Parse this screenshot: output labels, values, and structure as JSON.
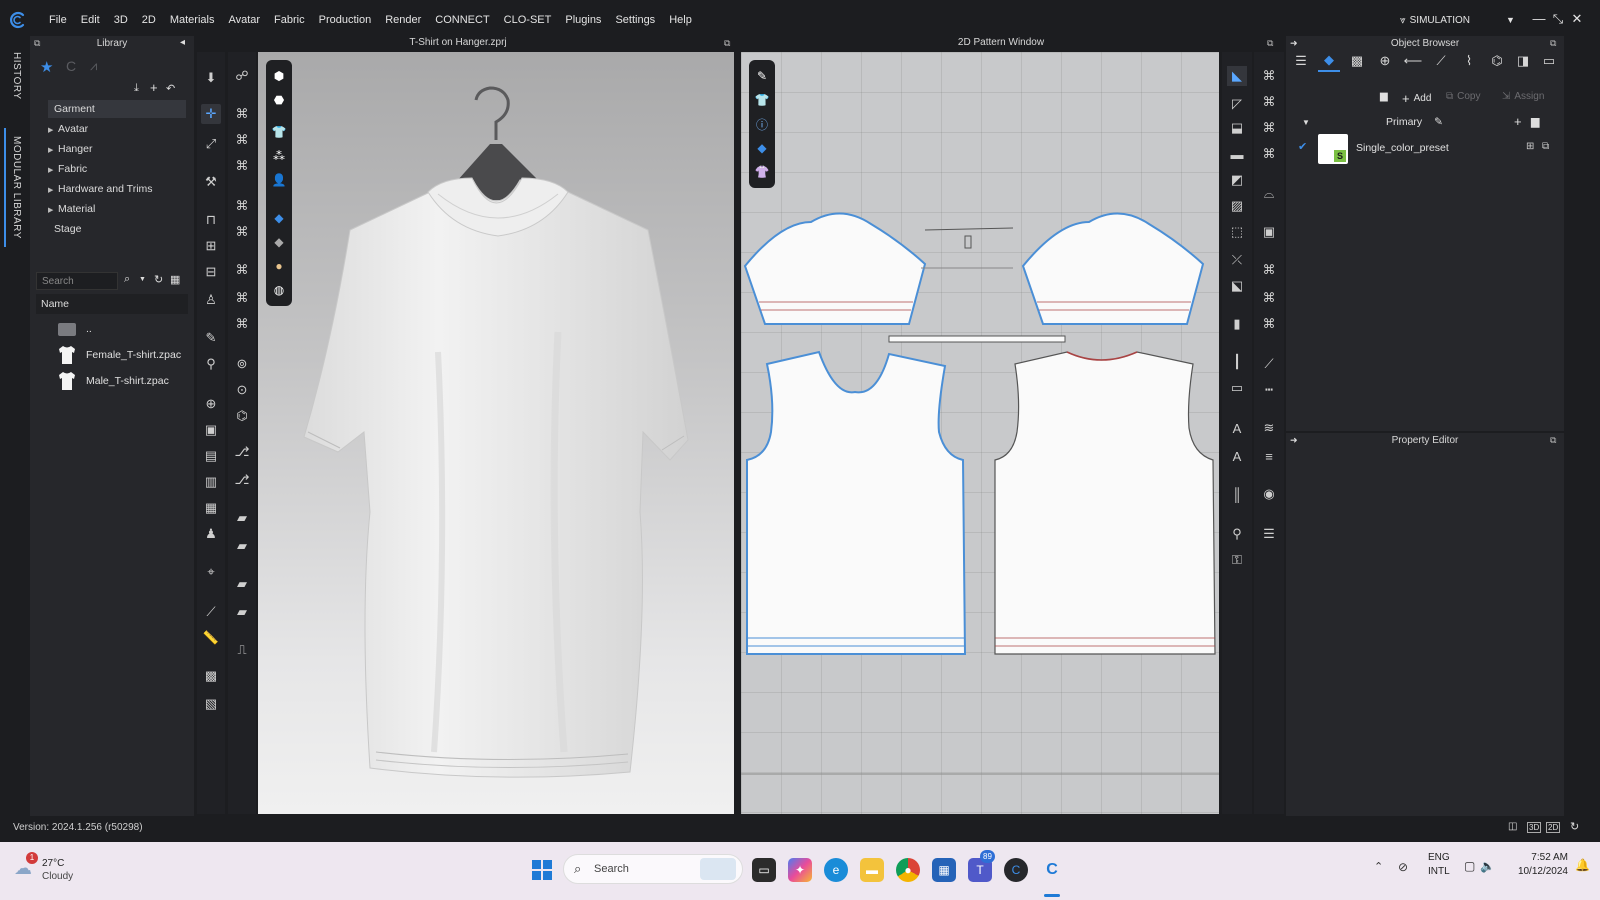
{
  "app": {
    "menus": [
      "File",
      "Edit",
      "3D",
      "2D",
      "Materials",
      "Avatar",
      "Fabric",
      "Production",
      "Render",
      "CONNECT",
      "CLO-SET",
      "Plugins",
      "Settings",
      "Help"
    ],
    "mode_label": "SIMULATION"
  },
  "side_tabs": {
    "history": "HISTORY",
    "modular_library": "MODULAR LIBRARY"
  },
  "library": {
    "title": "Library",
    "tree": [
      {
        "label": "Garment",
        "expandable": false,
        "selected": true
      },
      {
        "label": "Avatar",
        "expandable": true
      },
      {
        "label": "Hanger",
        "expandable": true
      },
      {
        "label": "Fabric",
        "expandable": true
      },
      {
        "label": "Hardware and Trims",
        "expandable": true
      },
      {
        "label": "Material",
        "expandable": true
      },
      {
        "label": "Stage",
        "expandable": false
      }
    ],
    "search_placeholder": "Search",
    "column_name": "Name",
    "files": [
      {
        "label": "..",
        "icon": "folder-icon"
      },
      {
        "label": "Female_T-shirt.zpac",
        "icon": "tshirt-icon"
      },
      {
        "label": "Male_T-shirt.zpac",
        "icon": "tshirt-icon"
      }
    ]
  },
  "viewport3d": {
    "title": "T-Shirt on Hanger.zprj"
  },
  "viewport2d": {
    "title": "2D Pattern Window"
  },
  "object_browser": {
    "title": "Object Browser",
    "add_label": "Add",
    "copy_label": "Copy",
    "assign_label": "Assign",
    "group_label": "Primary",
    "fabric_name": "Single_color_preset"
  },
  "property_editor": {
    "title": "Property Editor"
  },
  "status": {
    "version": "Version: 2024.1.256 (r50298)"
  },
  "taskbar": {
    "weather_temp": "27°C",
    "weather_desc": "Cloudy",
    "weather_badge": "1",
    "search_placeholder": "Search",
    "teams_badge": "89",
    "lang_1": "ENG",
    "lang_2": "INTL",
    "time": "7:52 AM",
    "date": "10/12/2024"
  },
  "colors": {
    "accent_blue": "#3d8ee8",
    "app_bg": "#1c1d20",
    "panel_bg": "#26272b",
    "taskbar_bg": "#eee7f0"
  }
}
